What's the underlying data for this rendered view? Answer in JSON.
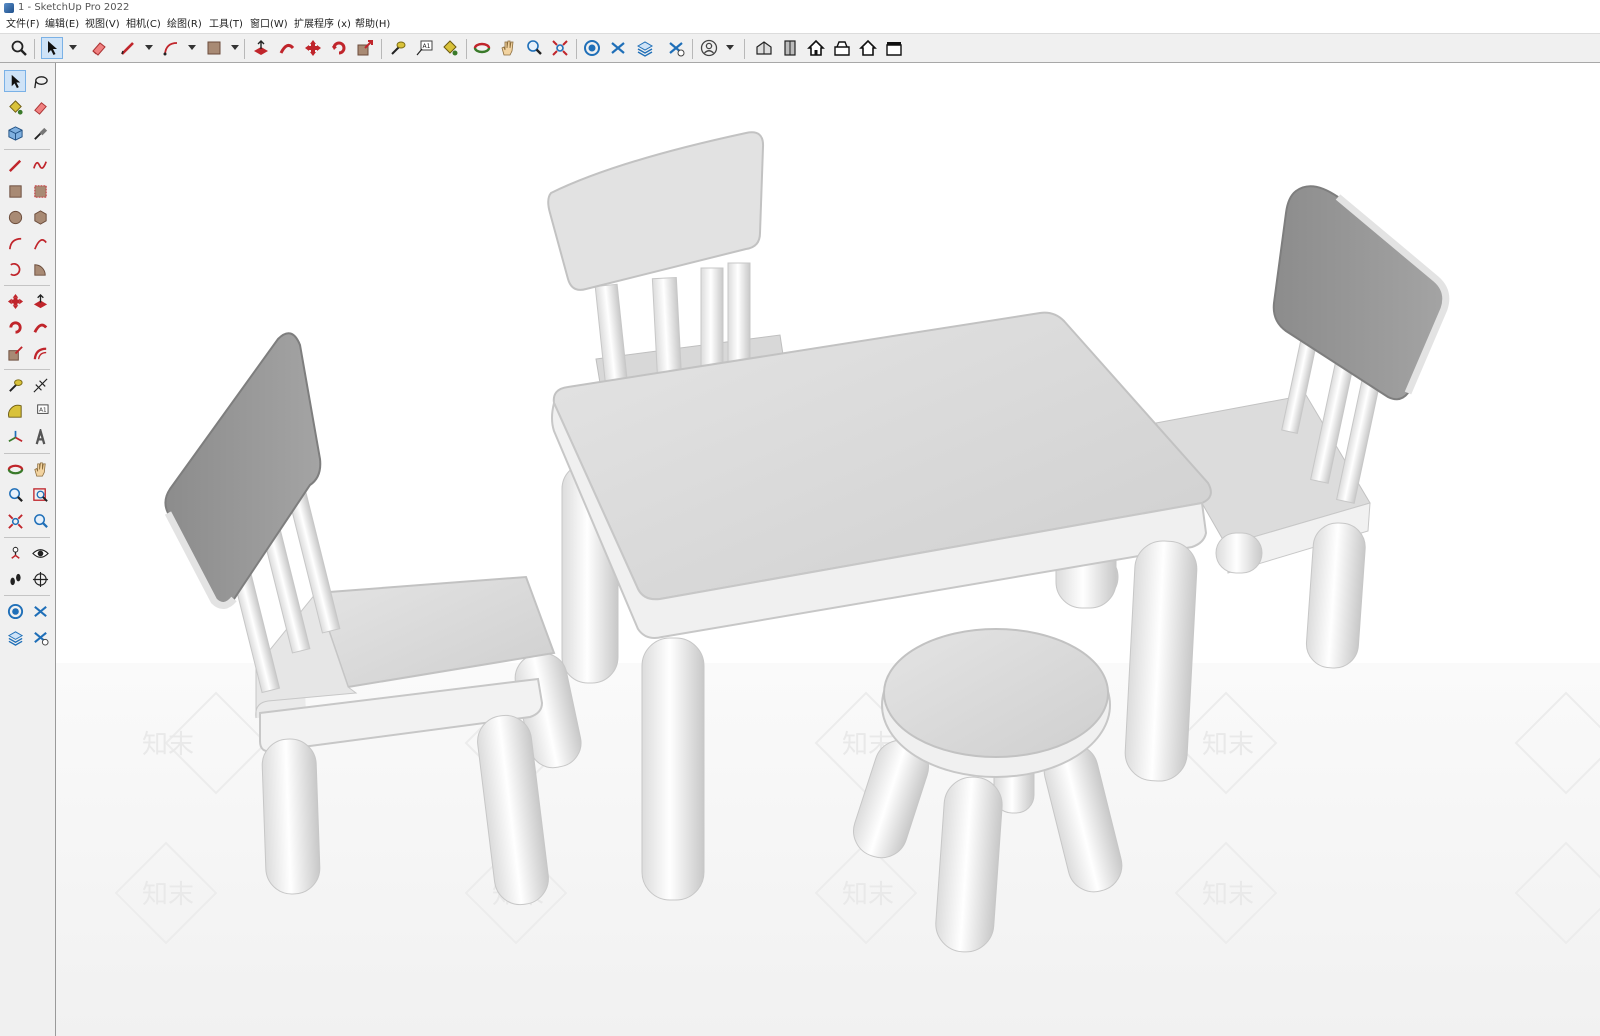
{
  "window": {
    "title": "1 - SketchUp Pro 2022"
  },
  "menu": [
    {
      "label": "文件(F)"
    },
    {
      "label": "编辑(E)"
    },
    {
      "label": "视图(V)"
    },
    {
      "label": "相机(C)"
    },
    {
      "label": "绘图(R)"
    },
    {
      "label": "工具(T)"
    },
    {
      "label": "窗口(W)"
    },
    {
      "label": "扩展程序 (x)"
    },
    {
      "label": "帮助(H)"
    }
  ],
  "toolbar": {
    "active_tool": "select"
  },
  "viewport": {
    "model": "children-table-chairs-stool",
    "watermark": "知末",
    "colors": {
      "surface": "#e6e6e6",
      "shadow": "#8e8e8e",
      "ground": "#f6f6f6",
      "backrest": "#9a9a9a"
    }
  },
  "colors": {
    "toolbar_bg": "#f0f0f0",
    "active_highlight": "#cfe3f7",
    "accent_blue": "#1f6fb8",
    "accent_red": "#c0252b"
  }
}
